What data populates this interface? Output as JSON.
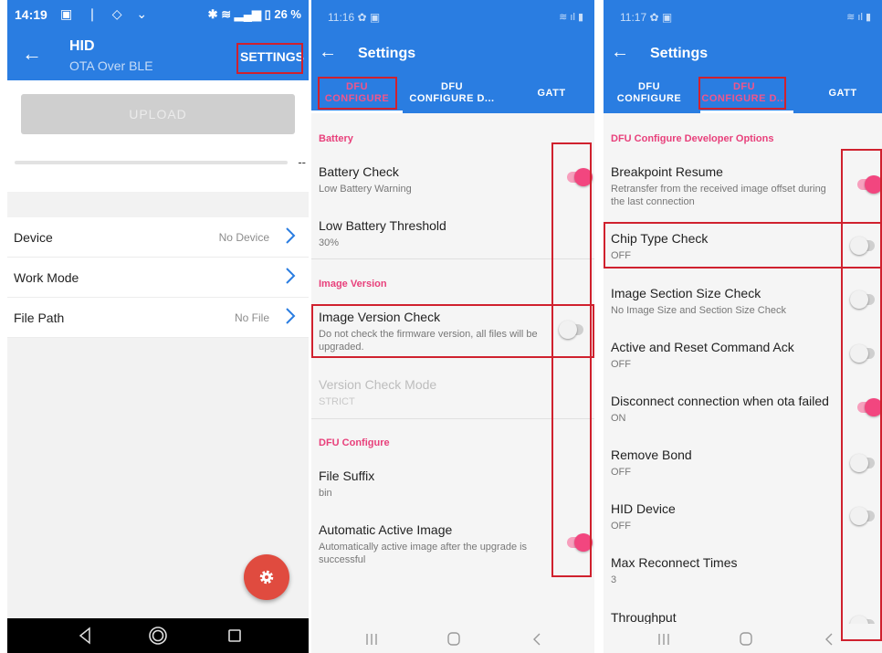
{
  "left_phone": {
    "status_bar": {
      "time": "14:19",
      "battery_text": "26 %"
    },
    "app_bar": {
      "title": "HID",
      "subtitle": "OTA Over BLE",
      "settings_label": "SETTINGS"
    },
    "upload_label": "UPLOAD",
    "progress_value": "--",
    "rows": [
      {
        "label": "Device",
        "value": "No Device"
      },
      {
        "label": "Work Mode",
        "value": ""
      },
      {
        "label": "File Path",
        "value": "No File"
      }
    ]
  },
  "middle_phone": {
    "status_bar": {
      "time": "11:16"
    },
    "app_bar_title": "Settings",
    "tabs": [
      {
        "line1": "DFU",
        "line2": "CONFIGURE"
      },
      {
        "line1": "DFU",
        "line2": "CONFIGURE D..."
      },
      {
        "line1": "GATT"
      }
    ],
    "sections": {
      "battery": "Battery",
      "image_version": "Image Version",
      "dfu_configure": "DFU Configure"
    },
    "items": {
      "battery_check": {
        "title": "Battery Check",
        "summary": "Low Battery Warning",
        "on": true
      },
      "low_battery_threshold": {
        "title": "Low Battery Threshold",
        "summary": "30%"
      },
      "image_version_check": {
        "title": "Image Version Check",
        "summary": "Do not check the firmware version, all files will be upgraded.",
        "on": false
      },
      "version_check_mode": {
        "title": "Version Check Mode",
        "summary": "STRICT"
      },
      "file_suffix": {
        "title": "File Suffix",
        "summary": "bin"
      },
      "automatic_active_image": {
        "title": "Automatic Active Image",
        "summary": "Automatically active image after the upgrade is successful",
        "on": true
      }
    }
  },
  "right_phone": {
    "status_bar": {
      "time": "11:17"
    },
    "app_bar_title": "Settings",
    "tabs": [
      {
        "line1": "DFU",
        "line2": "CONFIGURE"
      },
      {
        "line1": "DFU",
        "line2": "CONFIGURE D..."
      },
      {
        "line1": "GATT"
      }
    ],
    "section": "DFU Configure Developer Options",
    "items": [
      {
        "title": "Breakpoint Resume",
        "summary": "Retransfer from the received image offset during the last connection",
        "on": true
      },
      {
        "title": "Chip Type Check",
        "summary": "OFF",
        "on": false
      },
      {
        "title": "Image Section Size Check",
        "summary": "No Image Size and Section Size Check",
        "on": false
      },
      {
        "title": "Active and Reset Command Ack",
        "summary": "OFF",
        "on": false
      },
      {
        "title": "Disconnect connection when ota failed",
        "summary": "ON",
        "on": true
      },
      {
        "title": "Remove Bond",
        "summary": "OFF",
        "on": false
      },
      {
        "title": "HID Device",
        "summary": "OFF",
        "on": false
      },
      {
        "title": "Max Reconnect Times",
        "summary": "3"
      },
      {
        "title": "Throughput",
        "summary": "",
        "on": false
      }
    ]
  },
  "colors": {
    "primary": "#2a7de1",
    "accent": "#f2467f",
    "highlight": "#d0212e",
    "fab": "#e04b3f"
  }
}
